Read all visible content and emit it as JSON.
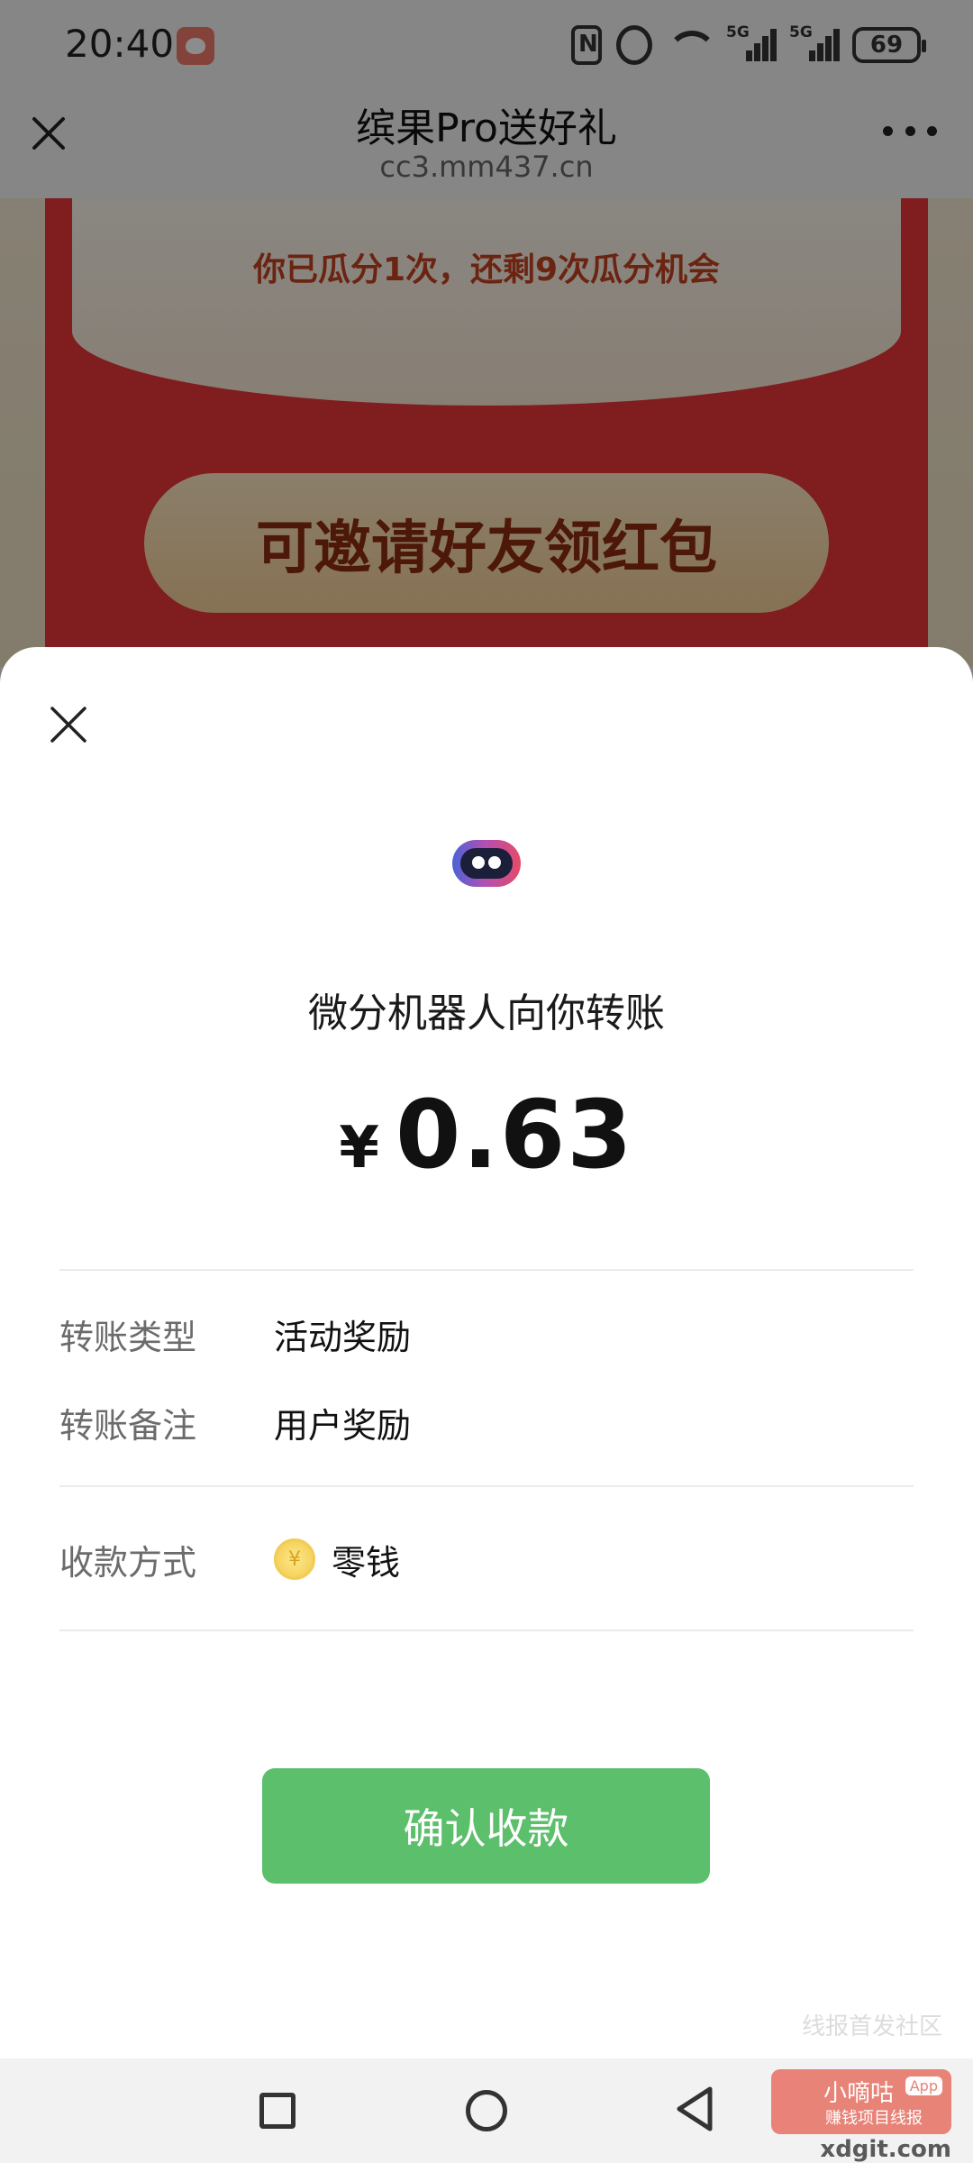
{
  "status_bar": {
    "time": "20:40",
    "battery": "69",
    "network_labels": [
      "5G",
      "5G"
    ]
  },
  "browser": {
    "title": "缤果Pro送好礼",
    "url": "cc3.mm437.cn"
  },
  "page": {
    "split_status": "你已瓜分1次，还剩9次瓜分机会",
    "invite_button": "可邀请好友领红包"
  },
  "transfer": {
    "sender_line": "微分机器人向你转账",
    "currency_symbol": "¥",
    "amount": "0.63",
    "type_label": "转账类型",
    "type_value": "活动奖励",
    "note_label": "转账备注",
    "note_value": "用户奖励",
    "method_label": "收款方式",
    "method_value": "零钱",
    "confirm_button": "确认收款"
  },
  "watermark": {
    "headline": "线报首发社区",
    "name": "小嘀咕",
    "tag": "App",
    "sub": "赚钱项目线报",
    "site": "xdgit.com"
  },
  "icons": {
    "close": "close-icon",
    "more": "more-icon",
    "logo": "robot-logo-icon",
    "coin": "coin-icon"
  },
  "colors": {
    "confirm_green": "#5bbf6b",
    "accent_red": "#e8353a"
  }
}
